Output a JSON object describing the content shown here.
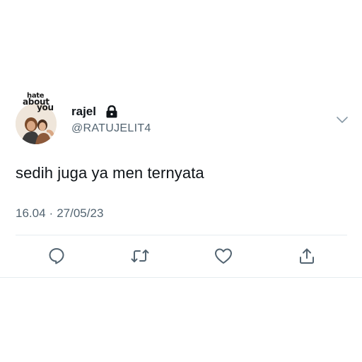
{
  "user": {
    "display_name": "rajel",
    "handle": "@RATUJELIT4",
    "avatar_title_lines": [
      "hate",
      "about",
      "you"
    ],
    "protected_icon": "lock-icon"
  },
  "tweet": {
    "text": "sedih juga ya men ternyata",
    "time": "16.04",
    "separator": "·",
    "date": "27/05/23"
  },
  "actions": {
    "reply_icon": "reply-icon",
    "retweet_icon": "retweet-icon",
    "like_icon": "heart-icon",
    "share_icon": "share-icon",
    "more_icon": "chevron-down-icon"
  },
  "colors": {
    "text_primary": "#0f1419",
    "text_secondary": "#536471",
    "divider": "#e6ecf0",
    "icon": "#536471"
  }
}
